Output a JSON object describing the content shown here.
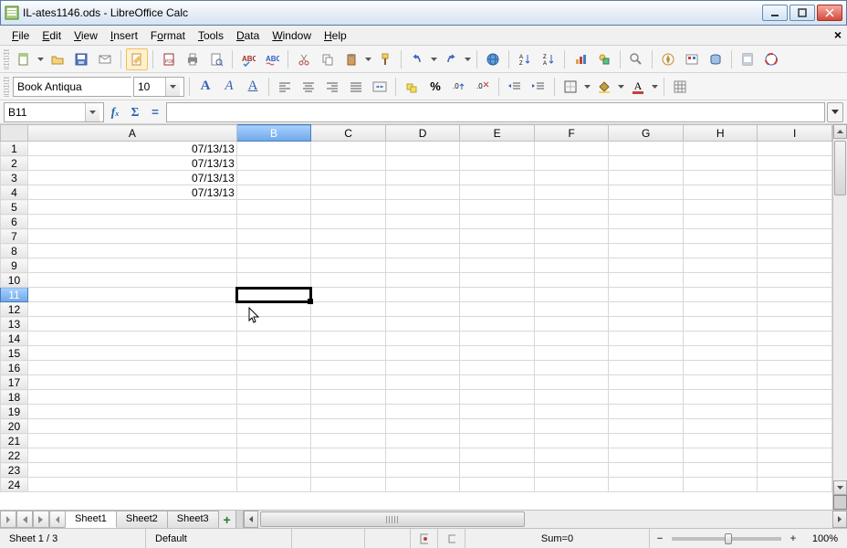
{
  "window": {
    "title": "IL-ates1146.ods - LibreOffice Calc"
  },
  "menu": {
    "items": [
      "File",
      "Edit",
      "View",
      "Insert",
      "Format",
      "Tools",
      "Data",
      "Window",
      "Help"
    ]
  },
  "formatting": {
    "font_name": "Book Antiqua",
    "font_size": "10"
  },
  "namebox": {
    "cell_ref": "B11"
  },
  "formula_bar": {
    "value": ""
  },
  "columns": [
    "A",
    "B",
    "C",
    "D",
    "E",
    "F",
    "G",
    "H",
    "I"
  ],
  "selected_column": "B",
  "selected_row": 11,
  "rows_count": 24,
  "cells": {
    "A1": "07/13/13",
    "A2": "07/13/13",
    "A3": "07/13/13",
    "A4": "07/13/13"
  },
  "sheets": {
    "tabs": [
      "Sheet1",
      "Sheet2",
      "Sheet3"
    ],
    "active": "Sheet1"
  },
  "status": {
    "sheet_pos": "Sheet 1 / 3",
    "page_style": "Default",
    "sum": "Sum=0",
    "zoom": "100%"
  }
}
